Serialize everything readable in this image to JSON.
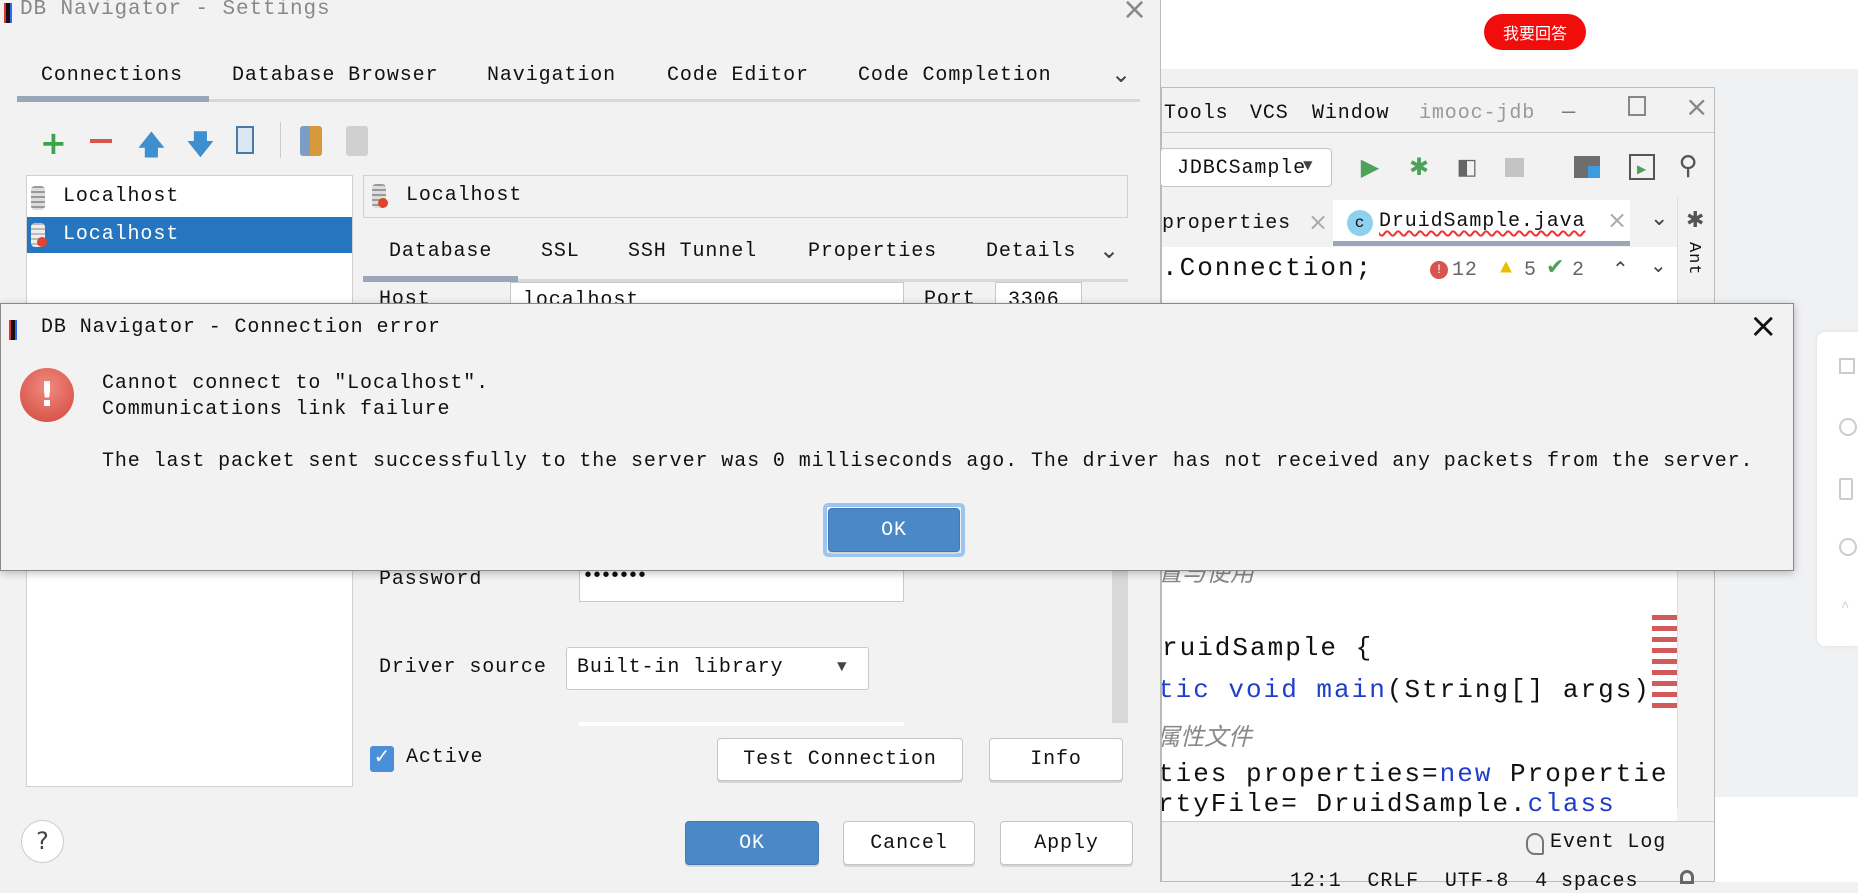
{
  "web": {
    "answer_button": "我要回答",
    "accent": "#f20d0d"
  },
  "ide": {
    "menu": [
      "Tools",
      "VCS",
      "Window"
    ],
    "project": "imooc-jdb",
    "run_config": "JDBCSample",
    "tabs": [
      {
        "label": "properties"
      },
      {
        "label": "DruidSample.java",
        "active": true
      }
    ],
    "inspections": {
      "errors": "12",
      "warnings": "5",
      "weak": "2"
    },
    "side_tool": "Ant",
    "code": {
      "l1": ".Connection;",
      "l2": "置与使用",
      "l3": "ruidSample {",
      "l4a": "tic ",
      "l4b": "void main",
      "l4c": "(String[] args)",
      "l5": "属性文件",
      "l6a": "ties properties=",
      "l6b": "new",
      "l6c": " Propertie",
      "l7a": "rtyFile= DruidSample.",
      "l7b": "class"
    },
    "event_log": "Event Log",
    "status": "12:1  CRLF  UTF-8  4 spaces"
  },
  "settings": {
    "title": "DB Navigator - Settings",
    "tabs": [
      "Connections",
      "Database Browser",
      "Navigation",
      "Code Editor",
      "Code Completion"
    ],
    "connections": [
      {
        "label": "Localhost"
      },
      {
        "label": "Localhost",
        "selected": true
      }
    ],
    "header": "Localhost",
    "subtabs": [
      "Database",
      "SSL",
      "SSH Tunnel",
      "Properties",
      "Details"
    ],
    "host_label": "Host",
    "host_value": "localhost",
    "port_label": "Port",
    "port_value": "3306",
    "password_label": "Password",
    "password_value": "•••••••",
    "driver_label": "Driver source",
    "driver_value": "Built-in library",
    "active_label": "Active",
    "active_checked": true,
    "test_connection": "Test Connection",
    "info": "Info",
    "ok": "OK",
    "cancel": "Cancel",
    "apply": "Apply",
    "help": "?"
  },
  "error": {
    "title": "DB Navigator - Connection error",
    "line1": "Cannot connect to \"Localhost\".",
    "line2": "Communications link failure",
    "line3": "The last packet sent successfully to the server was 0 milliseconds ago. The driver has not received any packets from the server.",
    "ok": "OK"
  }
}
